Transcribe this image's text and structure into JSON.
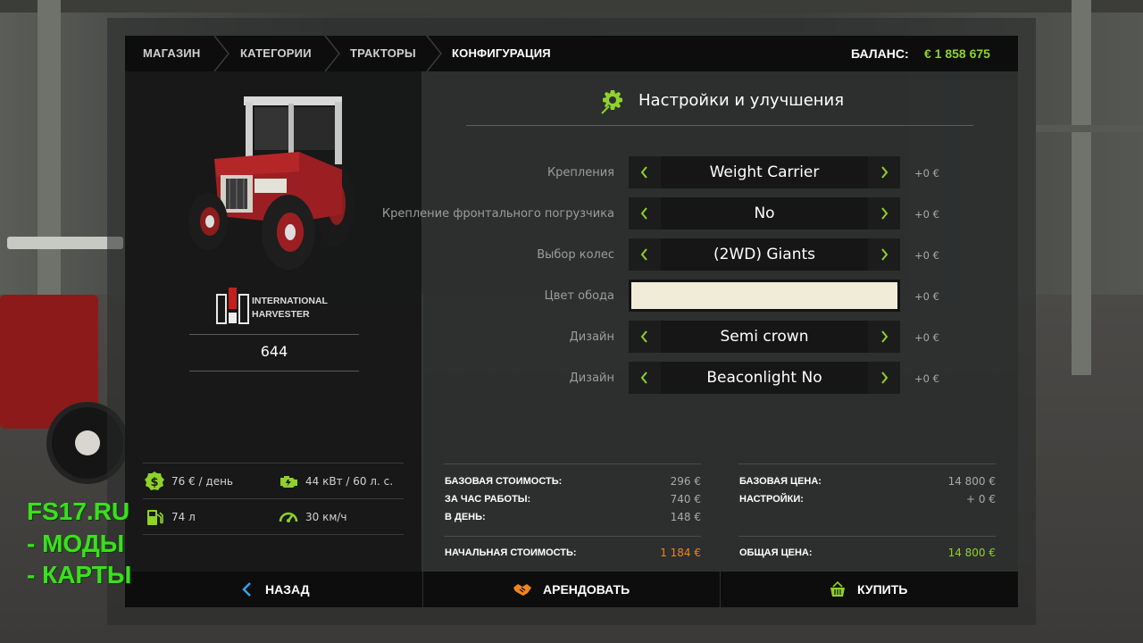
{
  "breadcrumb": {
    "items": [
      "МАГАЗИН",
      "КАТЕГОРИИ",
      "ТРАКТОРЫ",
      "КОНФИГУРАЦИЯ"
    ]
  },
  "balance": {
    "label": "БАЛАНС:",
    "value": "€ 1 858 675"
  },
  "vehicle": {
    "brand_line1": "INTERNATIONAL",
    "brand_line2": "HARVESTER",
    "model": "644",
    "stats": {
      "daily_cost": "76 € / день",
      "power": "44 кВт / 60 л. с.",
      "fuel": "74 л",
      "speed": "30 км/ч"
    }
  },
  "config": {
    "heading": "Настройки и улучшения",
    "options": [
      {
        "label": "Крепления",
        "value": "Weight Carrier",
        "price": "+0 €"
      },
      {
        "label": "Крепление фронтального погрузчика",
        "value": "No",
        "price": "+0 €"
      },
      {
        "label": "Выбор колес",
        "value": "(2WD) Giants",
        "price": "+0 €"
      },
      {
        "label": "Цвет обода",
        "value": "",
        "price": "+0 €",
        "color": "#f1ecd8"
      },
      {
        "label": "Дизайн",
        "value": "Semi crown",
        "price": "+0 €"
      },
      {
        "label": "Дизайн",
        "value": "Beaconlight No",
        "price": "+0 €"
      }
    ]
  },
  "costs": {
    "base_cost_label": "БАЗОВАЯ СТОИМОСТЬ:",
    "base_cost": "296 €",
    "per_hour_label": "ЗА ЧАС РАБОТЫ:",
    "per_hour": "740 €",
    "per_day_label": "В ДЕНЬ:",
    "per_day": "148 €",
    "initial_label": "НАЧАЛЬНАЯ СТОИМОСТЬ:",
    "initial": "1 184 €",
    "base_price_label": "БАЗОВАЯ ЦЕНА:",
    "base_price": "14 800 €",
    "settings_label": "НАСТРОЙКИ:",
    "settings": "+ 0 €",
    "total_label": "ОБЩАЯ ЦЕНА:",
    "total": "14 800 €"
  },
  "actions": {
    "back": "НАЗАД",
    "lease": "АРЕНДОВАТЬ",
    "buy": "КУПИТЬ"
  },
  "watermark": {
    "line1": "FS17.RU",
    "line2": "- МОДЫ",
    "line3": "- КАРТЫ"
  },
  "colors": {
    "accent": "#8fd22a",
    "orange": "#f0841d",
    "blue": "#3aa0e6"
  }
}
